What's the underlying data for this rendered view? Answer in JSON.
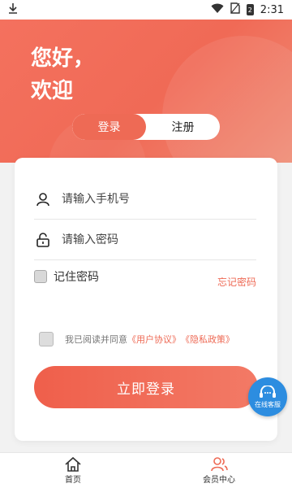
{
  "status_bar": {
    "time": "2:31",
    "battery_label": "2"
  },
  "hero": {
    "greeting_line1": "您好，",
    "greeting_line2": "欢迎"
  },
  "tabs": [
    {
      "label": "登录",
      "active": true
    },
    {
      "label": "注册",
      "active": false
    }
  ],
  "form": {
    "phone_placeholder": "请输入手机号",
    "password_placeholder": "请输入密码",
    "remember_label": "记住密码",
    "forgot_label": "忘记密码",
    "agree_prefix": "我已阅读并同意",
    "user_agreement": "《用户协议》",
    "privacy_policy": "《隐私政策》",
    "login_button": "立即登录"
  },
  "service_button": {
    "label": "在线客服"
  },
  "bottom_nav": [
    {
      "label": "首页",
      "icon": "home-icon"
    },
    {
      "label": "会员中心",
      "icon": "user-icon"
    }
  ],
  "colors": {
    "accent": "#ee6a55",
    "service": "#2d8de0"
  }
}
